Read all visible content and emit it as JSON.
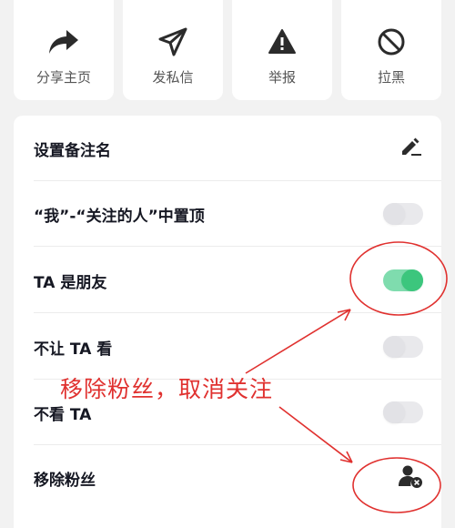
{
  "actions": [
    {
      "label": "分享主页",
      "icon": "share-arrow-icon"
    },
    {
      "label": "发私信",
      "icon": "paper-plane-icon"
    },
    {
      "label": "举报",
      "icon": "warning-triangle-icon"
    },
    {
      "label": "拉黑",
      "icon": "block-icon"
    }
  ],
  "settings": {
    "rows": [
      {
        "label": "设置备注名",
        "control": "edit-pencil-icon"
      },
      {
        "label": "“我”-“关注的人”中置顶",
        "control": "toggle",
        "on": false
      },
      {
        "label": "TA 是朋友",
        "control": "toggle",
        "on": true
      },
      {
        "label": "不让 TA 看",
        "control": "toggle",
        "on": false
      },
      {
        "label": "不看 TA",
        "control": "toggle",
        "on": false
      },
      {
        "label": "移除粉丝",
        "control": "remove-user-icon"
      }
    ]
  },
  "annotation": {
    "text": "移除粉丝，取消关注",
    "color": "#e0312f"
  },
  "colors": {
    "toggle_on_track": "#7fdcae",
    "toggle_on_knob": "#3cc67d"
  }
}
